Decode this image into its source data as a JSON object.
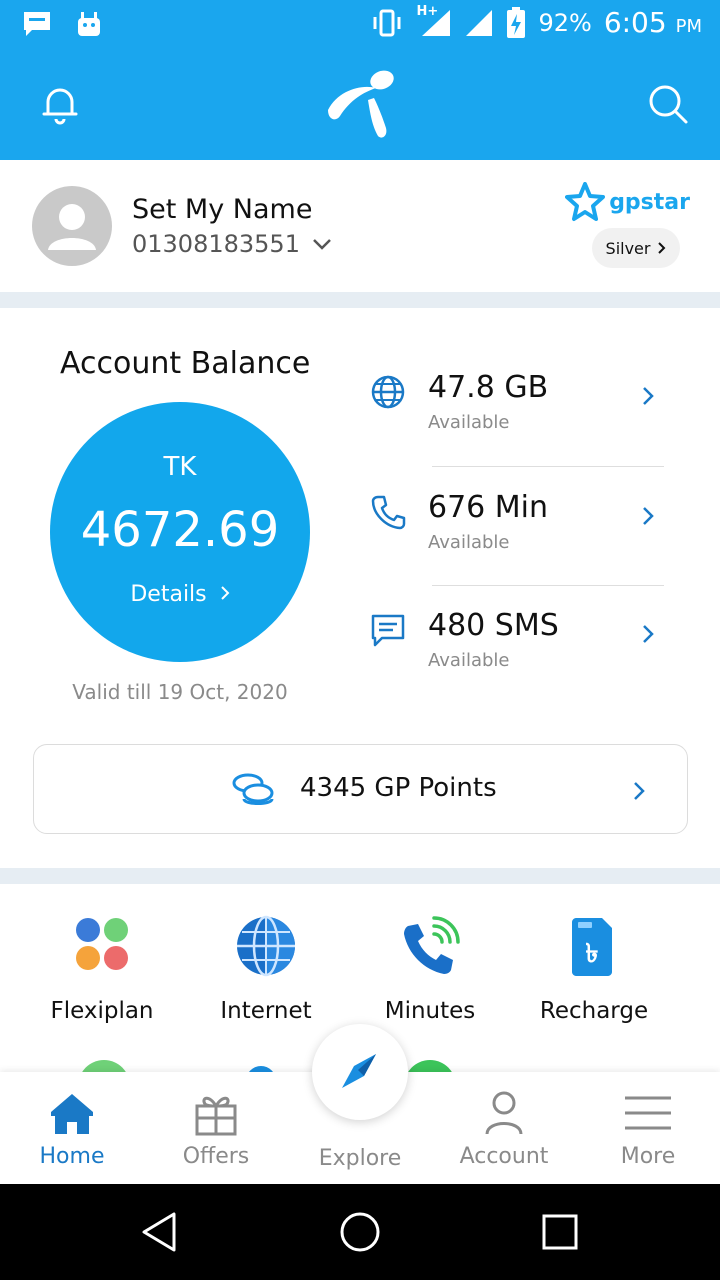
{
  "status_bar": {
    "network_label": "H+",
    "battery": "92%",
    "time": "6:05",
    "ampm": "PM"
  },
  "profile": {
    "name": "Set My Name",
    "number": "01308183551",
    "brand": "gpstar",
    "tier": "Silver"
  },
  "balance": {
    "title": "Account Balance",
    "currency": "TK",
    "amount": "4672.69",
    "details_label": "Details",
    "valid_till": "Valid till 19 Oct, 2020"
  },
  "usage": [
    {
      "value": "47.8 GB",
      "label": "Available",
      "icon": "globe-icon"
    },
    {
      "value": "676 Min",
      "label": "Available",
      "icon": "phone-icon"
    },
    {
      "value": "480 SMS",
      "label": "Available",
      "icon": "message-icon"
    }
  ],
  "points": {
    "text": "4345 GP Points",
    "icon": "coins-icon"
  },
  "services": [
    {
      "label": "Flexiplan",
      "icon": "flexiplan-icon"
    },
    {
      "label": "Internet",
      "icon": "internet-globe-icon"
    },
    {
      "label": "Minutes",
      "icon": "phone-call-icon"
    },
    {
      "label": "Recharge",
      "icon": "recharge-sim-icon"
    }
  ],
  "bottom_nav": [
    {
      "label": "Home",
      "icon": "home-icon",
      "active": true
    },
    {
      "label": "Offers",
      "icon": "gift-icon"
    },
    {
      "label": "Explore",
      "icon": "compass-icon"
    },
    {
      "label": "Account",
      "icon": "person-icon"
    },
    {
      "label": "More",
      "icon": "menu-icon"
    }
  ],
  "colors": {
    "brand_blue": "#1aa6ee",
    "circle_blue": "#12a7ec",
    "active_nav": "#1a79c6",
    "separator": "#e6edf3"
  }
}
